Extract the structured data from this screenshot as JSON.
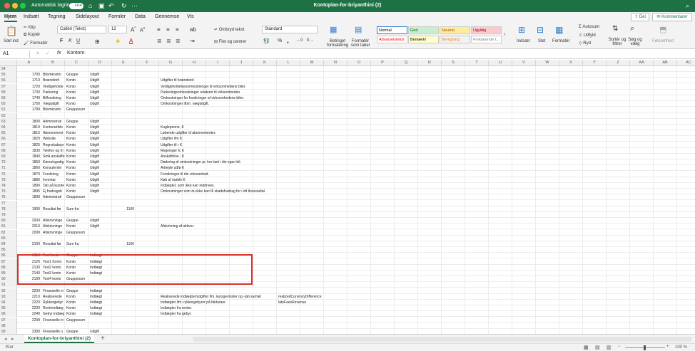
{
  "titlebar": {
    "autosave_label": "Automatisk lagring",
    "autosave_state": "FRA",
    "document_title": "Kontoplan-for-briyanthini (2)"
  },
  "menu": [
    "Hjem",
    "Indsæt",
    "Tegning",
    "Sidelayout",
    "Formler",
    "Data",
    "Gennemse",
    "Vis"
  ],
  "menu_active": "Hjem",
  "share": {
    "label": "Del",
    "comments_label": "Kommentarer"
  },
  "ribbon": {
    "paste": "Sæt ind",
    "cut": "Klip",
    "copy": "Kopiér",
    "format_painter": "Formatér",
    "font_name": "Calibri (Tekst)",
    "font_size": "12",
    "wrap_text": "Ombryd tekst",
    "merge_center": "Flet og centrer",
    "number_format": "Standard",
    "conditional_formatting": "Betinget formatering",
    "format_as_table": "Formatér som tabel",
    "styles": [
      {
        "label": "Normal",
        "bg": "#ffffff",
        "fg": "#000000"
      },
      {
        "label": "God",
        "bg": "#c6efce",
        "fg": "#006100"
      },
      {
        "label": "Neutral",
        "bg": "#ffeb9c",
        "fg": "#9c5700"
      },
      {
        "label": "Ugyldig",
        "bg": "#ffc7ce",
        "fg": "#9c0006"
      },
      {
        "label": "Advarselstekst",
        "bg": "#ffffff",
        "fg": "#ff0000"
      },
      {
        "label": "Bemærk!",
        "bg": "#ffffcc",
        "fg": "#000000"
      },
      {
        "label": "Beregning",
        "bg": "#f2f2f2",
        "fg": "#fa7d00"
      },
      {
        "label": "Forklarende t...",
        "bg": "#ffffff",
        "fg": "#7f7f7f"
      }
    ],
    "insert": "Indsæt",
    "delete": "Slet",
    "format": "Formatér",
    "autosum": "Autosum",
    "fill": "Udfyld",
    "clear": "Ryd",
    "sort_filter": "Sortér og filtrer",
    "find_select": "Søg og vælg",
    "sensitivity": "Følsomhed"
  },
  "formula_bar": {
    "name_box": "A1",
    "fx": "fx",
    "value": "Kontonr."
  },
  "columns": [
    "A",
    "B",
    "C",
    "D",
    "E",
    "F",
    "G",
    "H",
    "I",
    "J",
    "K",
    "L",
    "M",
    "N",
    "O",
    "P",
    "Q",
    "R",
    "S",
    "T",
    "U",
    "V",
    "W",
    "X",
    "Y",
    "Z",
    "AA",
    "AB",
    "AC"
  ],
  "rows": [
    {
      "n": "54",
      "c": []
    },
    {
      "n": "55",
      "c": [
        "1700",
        "Bilomkostni",
        "Gruppe",
        "Udgift"
      ]
    },
    {
      "n": "56",
      "c": [
        "1710",
        "Brændstof",
        "Konto",
        "Udgift",
        "",
        "",
        "Udgifter til brændstof."
      ]
    },
    {
      "n": "57",
      "c": [
        "1720",
        "Vedligeholde",
        "Konto",
        "Udgift",
        "",
        "",
        "Vedligeholdelsesomkostninger til virksomhedens biler."
      ]
    },
    {
      "n": "58",
      "c": [
        "1730",
        "Parkering",
        "Konto",
        "Udgift",
        "",
        "",
        "Parkeringsomkostninger relateret til virksomheden."
      ]
    },
    {
      "n": "59",
      "c": [
        "1740",
        "Bilforsikring",
        "Konto",
        "Udgift",
        "",
        "",
        "Omkostninger for forsikringer af virksomhedens biler."
      ]
    },
    {
      "n": "60",
      "c": [
        "1750",
        "Vægtafgift",
        "Konto",
        "Udgift",
        "",
        "",
        "Omkostninger ifbm. vægtafgift."
      ]
    },
    {
      "n": "61",
      "c": [
        "1799",
        "Bilomkostni",
        "Gruppesum"
      ]
    },
    {
      "n": "62",
      "c": []
    },
    {
      "n": "63",
      "c": [
        "1800",
        "Administrati",
        "Gruppe",
        "Udgift"
      ]
    },
    {
      "n": "64",
      "c": [
        "1810",
        "Kontorartikle",
        "Konto",
        "Udgift",
        "",
        "",
        "Kuglepenne,  K"
      ]
    },
    {
      "n": "65",
      "c": [
        "1815",
        "Abonnement",
        "Konto",
        "Udgift",
        "",
        "",
        "Løbende udgifter til abonnementer."
      ]
    },
    {
      "n": "66",
      "c": [
        "1820",
        "Website",
        "Konto",
        "Udgift",
        "",
        "",
        "Udgifter ifm K"
      ]
    },
    {
      "n": "67",
      "c": [
        "1825",
        "Regnskabspr",
        "Konto",
        "Udgift",
        "",
        "",
        "Udgifter til r K"
      ]
    },
    {
      "n": "68",
      "c": [
        "1830",
        "Telefon og In",
        "Konto",
        "Udgift",
        "",
        "",
        "Regninger fc K"
      ]
    },
    {
      "n": "69",
      "c": [
        "1840",
        "Små anskaffe",
        "Konto",
        "Udgift",
        "",
        "",
        "Anskaffelse ; K"
      ]
    },
    {
      "n": "70",
      "c": [
        "1850",
        "Kørselsgodtg",
        "Konto",
        "Udgift",
        "",
        "",
        "Dækning af omkostninger pr. km kørt i din egen bil."
      ]
    },
    {
      "n": "71",
      "c": [
        "1860",
        "Konsulenter",
        "Konto",
        "Udgift",
        "",
        "",
        "Arbejde udfø K"
      ]
    },
    {
      "n": "72",
      "c": [
        "1870",
        "Forsikring",
        "Konto",
        "Udgift",
        "",
        "",
        "Forsikringer til din virksomhed."
      ]
    },
    {
      "n": "73",
      "c": [
        "1880",
        "Inventar",
        "Konto",
        "Udgift",
        "",
        "",
        "Køb af møble K"
      ]
    },
    {
      "n": "74",
      "c": [
        "1890",
        "Tab på kunde",
        "Konto",
        "Udgift",
        "",
        "",
        "Indtægter, som ikke kan inddrives."
      ]
    },
    {
      "n": "75",
      "c": [
        "1895",
        "Ej fradragsb",
        "Konto",
        "Udgift",
        "",
        "",
        "Omkostninger som du ikke kan få skattefradrag for i dit årsresultat."
      ]
    },
    {
      "n": "76",
      "c": [
        "1899",
        "Administrati",
        "Gruppesum"
      ]
    },
    {
      "n": "77",
      "c": []
    },
    {
      "n": "78",
      "c": [
        "1900",
        "Resultat før",
        "Sum fra",
        "",
        "1100"
      ]
    },
    {
      "n": "79",
      "c": []
    },
    {
      "n": "80",
      "c": [
        "2000",
        "Afskrivninge",
        "Gruppe",
        "Udgift"
      ]
    },
    {
      "n": "81",
      "c": [
        "2010",
        "Afskrivninge",
        "Konto",
        "Udgift",
        "",
        "",
        "Afskrivning af aktiver."
      ]
    },
    {
      "n": "82",
      "c": [
        "2099",
        "Afskrivninge",
        "Gruppesum"
      ]
    },
    {
      "n": "83",
      "c": []
    },
    {
      "n": "84",
      "c": [
        "2100",
        "Resultat før",
        "Sum fra",
        "",
        "1100"
      ]
    },
    {
      "n": "85",
      "c": []
    },
    {
      "n": "86",
      "c": [
        "2110",
        "Test konto",
        "Gruppe",
        "Indtægt"
      ]
    },
    {
      "n": "87",
      "c": [
        "2120",
        "Test1 Konto",
        "Konto",
        "Indtægt"
      ]
    },
    {
      "n": "88",
      "c": [
        "2130",
        "Test2 konto",
        "Konto",
        "Indtægt"
      ]
    },
    {
      "n": "89",
      "c": [
        "2140",
        "Test3 konto",
        "Konto",
        "Indtægt"
      ]
    },
    {
      "n": "90",
      "c": [
        "2199",
        "Test4 konto",
        "Gruppesum"
      ]
    },
    {
      "n": "91",
      "c": []
    },
    {
      "n": "92",
      "c": [
        "2200",
        "Finansielle in",
        "Gruppe",
        "Indtægt"
      ]
    },
    {
      "n": "93",
      "c": [
        "2210",
        "Realiserede",
        "Konto",
        "Indtægt",
        "",
        "",
        "Realiserede indtægter/udgifter ifm. kursgevinster og -tab samlet",
        "",
        "",
        "",
        "",
        "realizedCurrencyDifference"
      ]
    },
    {
      "n": "94",
      "c": [
        "2220",
        "Rykkergebyr",
        "Konto",
        "Indtægt",
        "",
        "",
        "Indtægter ifm. rykkergebyrer på fakturaer.",
        "",
        "",
        "",
        "",
        "lateFeesRevenue"
      ]
    },
    {
      "n": "95",
      "c": [
        "2230",
        "Renteindtæg",
        "Konto",
        "Indtægt",
        "",
        "",
        "Indtægter fra renter."
      ]
    },
    {
      "n": "96",
      "c": [
        "2240",
        "Gebyr indtæg",
        "Konto",
        "Indtægt",
        "",
        "",
        "Indtægter fra gebyr."
      ]
    },
    {
      "n": "97",
      "c": [
        "2299",
        "Finansielle in",
        "Gruppesum"
      ]
    },
    {
      "n": "98",
      "c": []
    },
    {
      "n": "99",
      "c": [
        "2300",
        "Finansielle u",
        "Gruppe",
        "Udgift"
      ]
    }
  ],
  "sheet_tab": "Kontoplan-for-briyanthini (2)",
  "status": {
    "ready": "Klar",
    "zoom": "100 %"
  }
}
